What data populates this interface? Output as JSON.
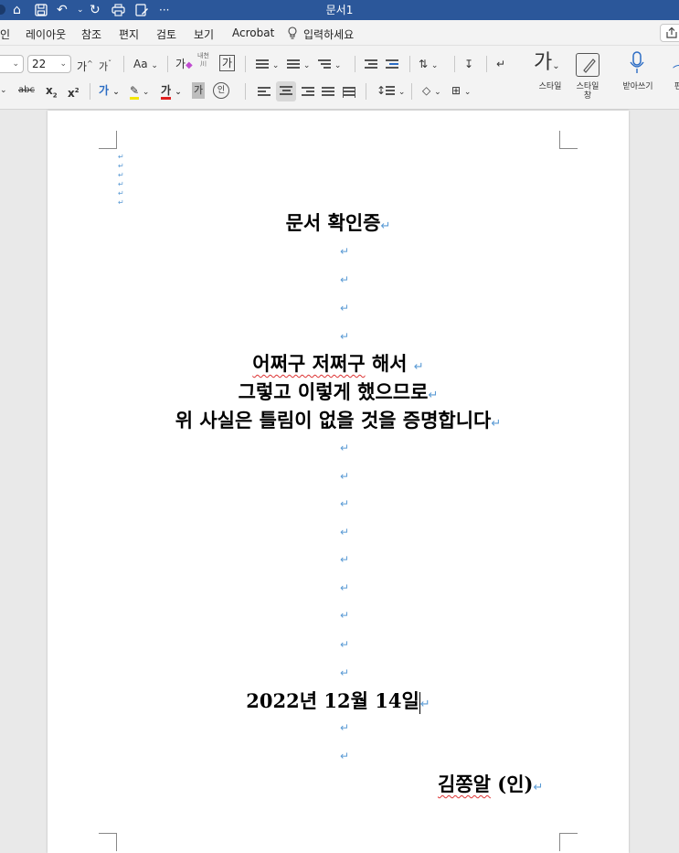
{
  "window": {
    "title": "문서1"
  },
  "quick_access": {
    "icons": [
      "home-icon",
      "save-icon",
      "undo-icon",
      "redo-icon",
      "print-icon",
      "edit-icon"
    ],
    "more": "···"
  },
  "menu": {
    "tabs": [
      "인",
      "레이아웃",
      "참조",
      "편지",
      "검토",
      "보기",
      "Acrobat"
    ],
    "tell_me": "입력하세요"
  },
  "ribbon": {
    "font_size": "22",
    "grow_font": "가",
    "shrink_font": "가",
    "change_case": "Aa",
    "clear_format": "가",
    "ruby_top": "내천",
    "ruby_bottom": "川",
    "char_border": "가",
    "strikethrough": "abc",
    "subscript": "x",
    "superscript": "x",
    "font_color_sample": "가",
    "shading": "가",
    "enclose": "인",
    "styles_label": "스타일",
    "styles_big": "가",
    "styles_pane_label_1": "스타일",
    "styles_pane_label_2": "창",
    "dictate_label": "받아쓰기",
    "more_label": "편"
  },
  "document": {
    "title": "문서 확인증",
    "body_line1_a": "어쩌구 저쩌구",
    "body_line1_b": " 해서 ",
    "body_line2": "그렇고 이렇게 했으므로",
    "body_line3": "위 사실은 틀림이 없을 것을 증명합니다",
    "date": "2022년 12월 14일",
    "signature_name": "김쫑알",
    "signature_suffix": " (인)",
    "paragraph_mark": "↵"
  },
  "colors": {
    "titlebar": "#2b579a",
    "paragraph_mark": "#5b9bd5",
    "spell_error": "#d33333"
  }
}
